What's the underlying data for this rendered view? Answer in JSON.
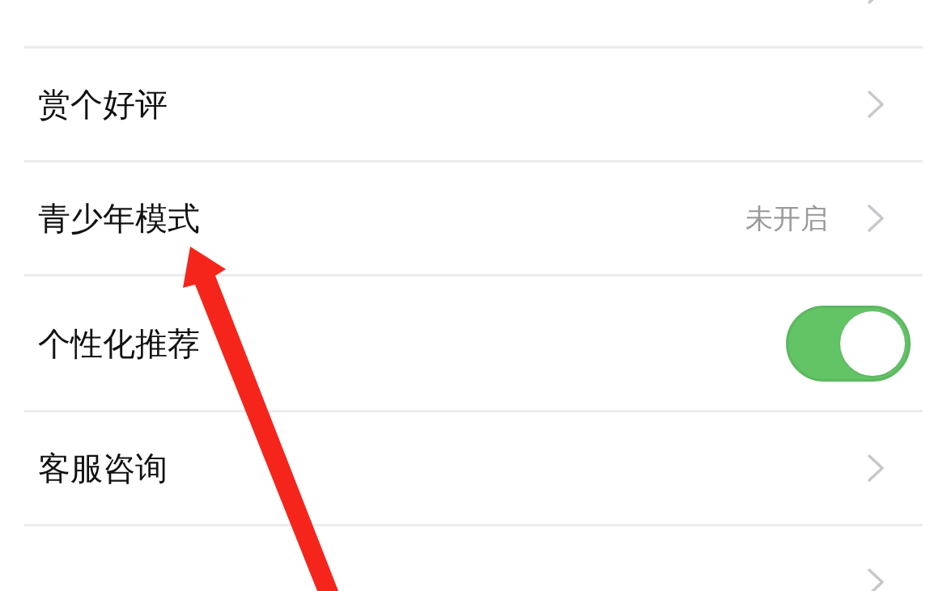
{
  "settings": [
    {
      "kind": "link"
    },
    {
      "kind": "link",
      "label": "赏个好评"
    },
    {
      "kind": "link",
      "label": "青少年模式",
      "value": "未开启"
    },
    {
      "kind": "toggle",
      "label": "个性化推荐",
      "on": true
    },
    {
      "kind": "link",
      "label": "客服咨询"
    },
    {
      "kind": "link"
    }
  ]
}
